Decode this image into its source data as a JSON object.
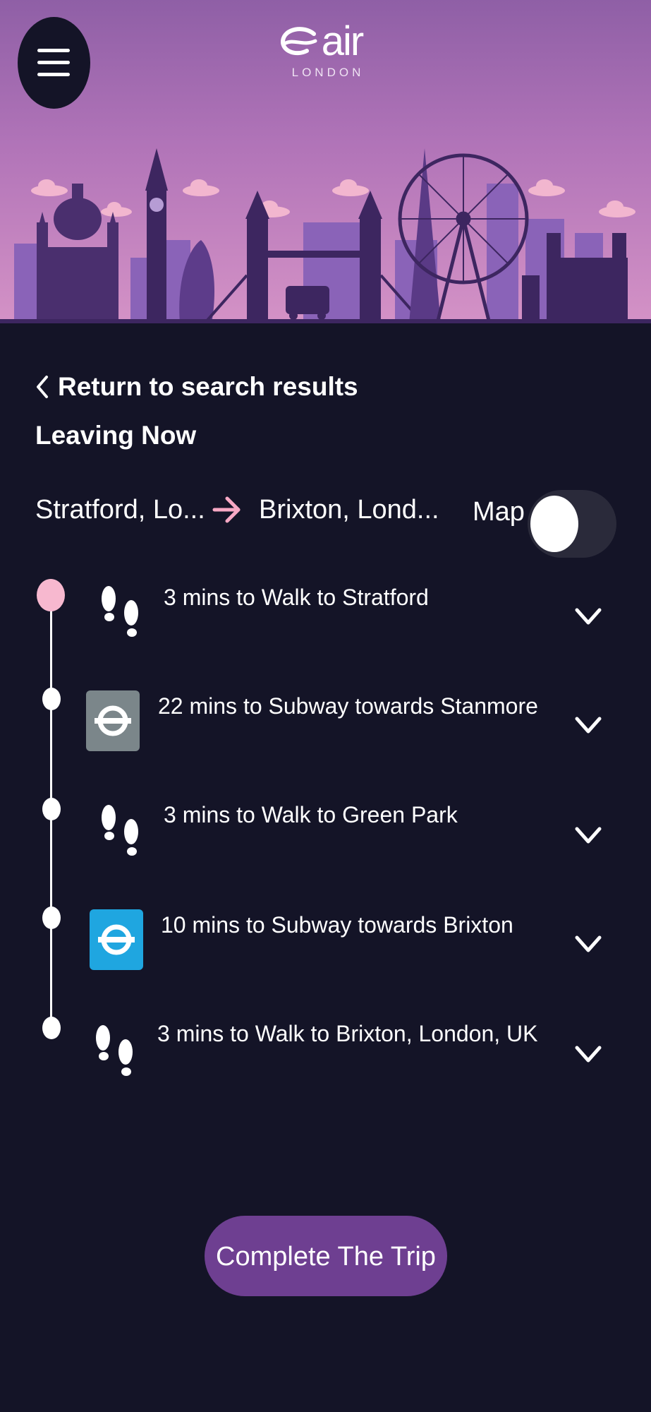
{
  "app": {
    "logo_text": "air",
    "logo_subtitle": "LONDON"
  },
  "nav": {
    "back_label": "Return to search results"
  },
  "trip": {
    "leaving_label": "Leaving Now",
    "from": "Stratford, Lo...",
    "to": "Brixton, Lond...",
    "map_label": "Map",
    "map_toggle_on": false
  },
  "steps": [
    {
      "text": "3 mins to Walk to Stratford",
      "icon": "footsteps-icon",
      "mode": "walk"
    },
    {
      "text": "22 mins to Subway towards Stanmore",
      "icon": "underground-roundel-icon",
      "mode": "subway",
      "color": "#7b868a"
    },
    {
      "text": "3 mins to Walk to Green Park",
      "icon": "footsteps-icon",
      "mode": "walk"
    },
    {
      "text": "10 mins to Subway towards Brixton",
      "icon": "underground-roundel-icon",
      "mode": "subway",
      "color": "#1fa6e0"
    },
    {
      "text": "3 mins to Walk to Brixton, London, UK",
      "icon": "footsteps-icon",
      "mode": "walk"
    }
  ],
  "actions": {
    "complete_label": "Complete The Trip"
  },
  "colors": {
    "background": "#141427",
    "accent_button": "#6e3f91",
    "arrow": "#f7a8c4",
    "first_dot": "#f7b8cf"
  }
}
